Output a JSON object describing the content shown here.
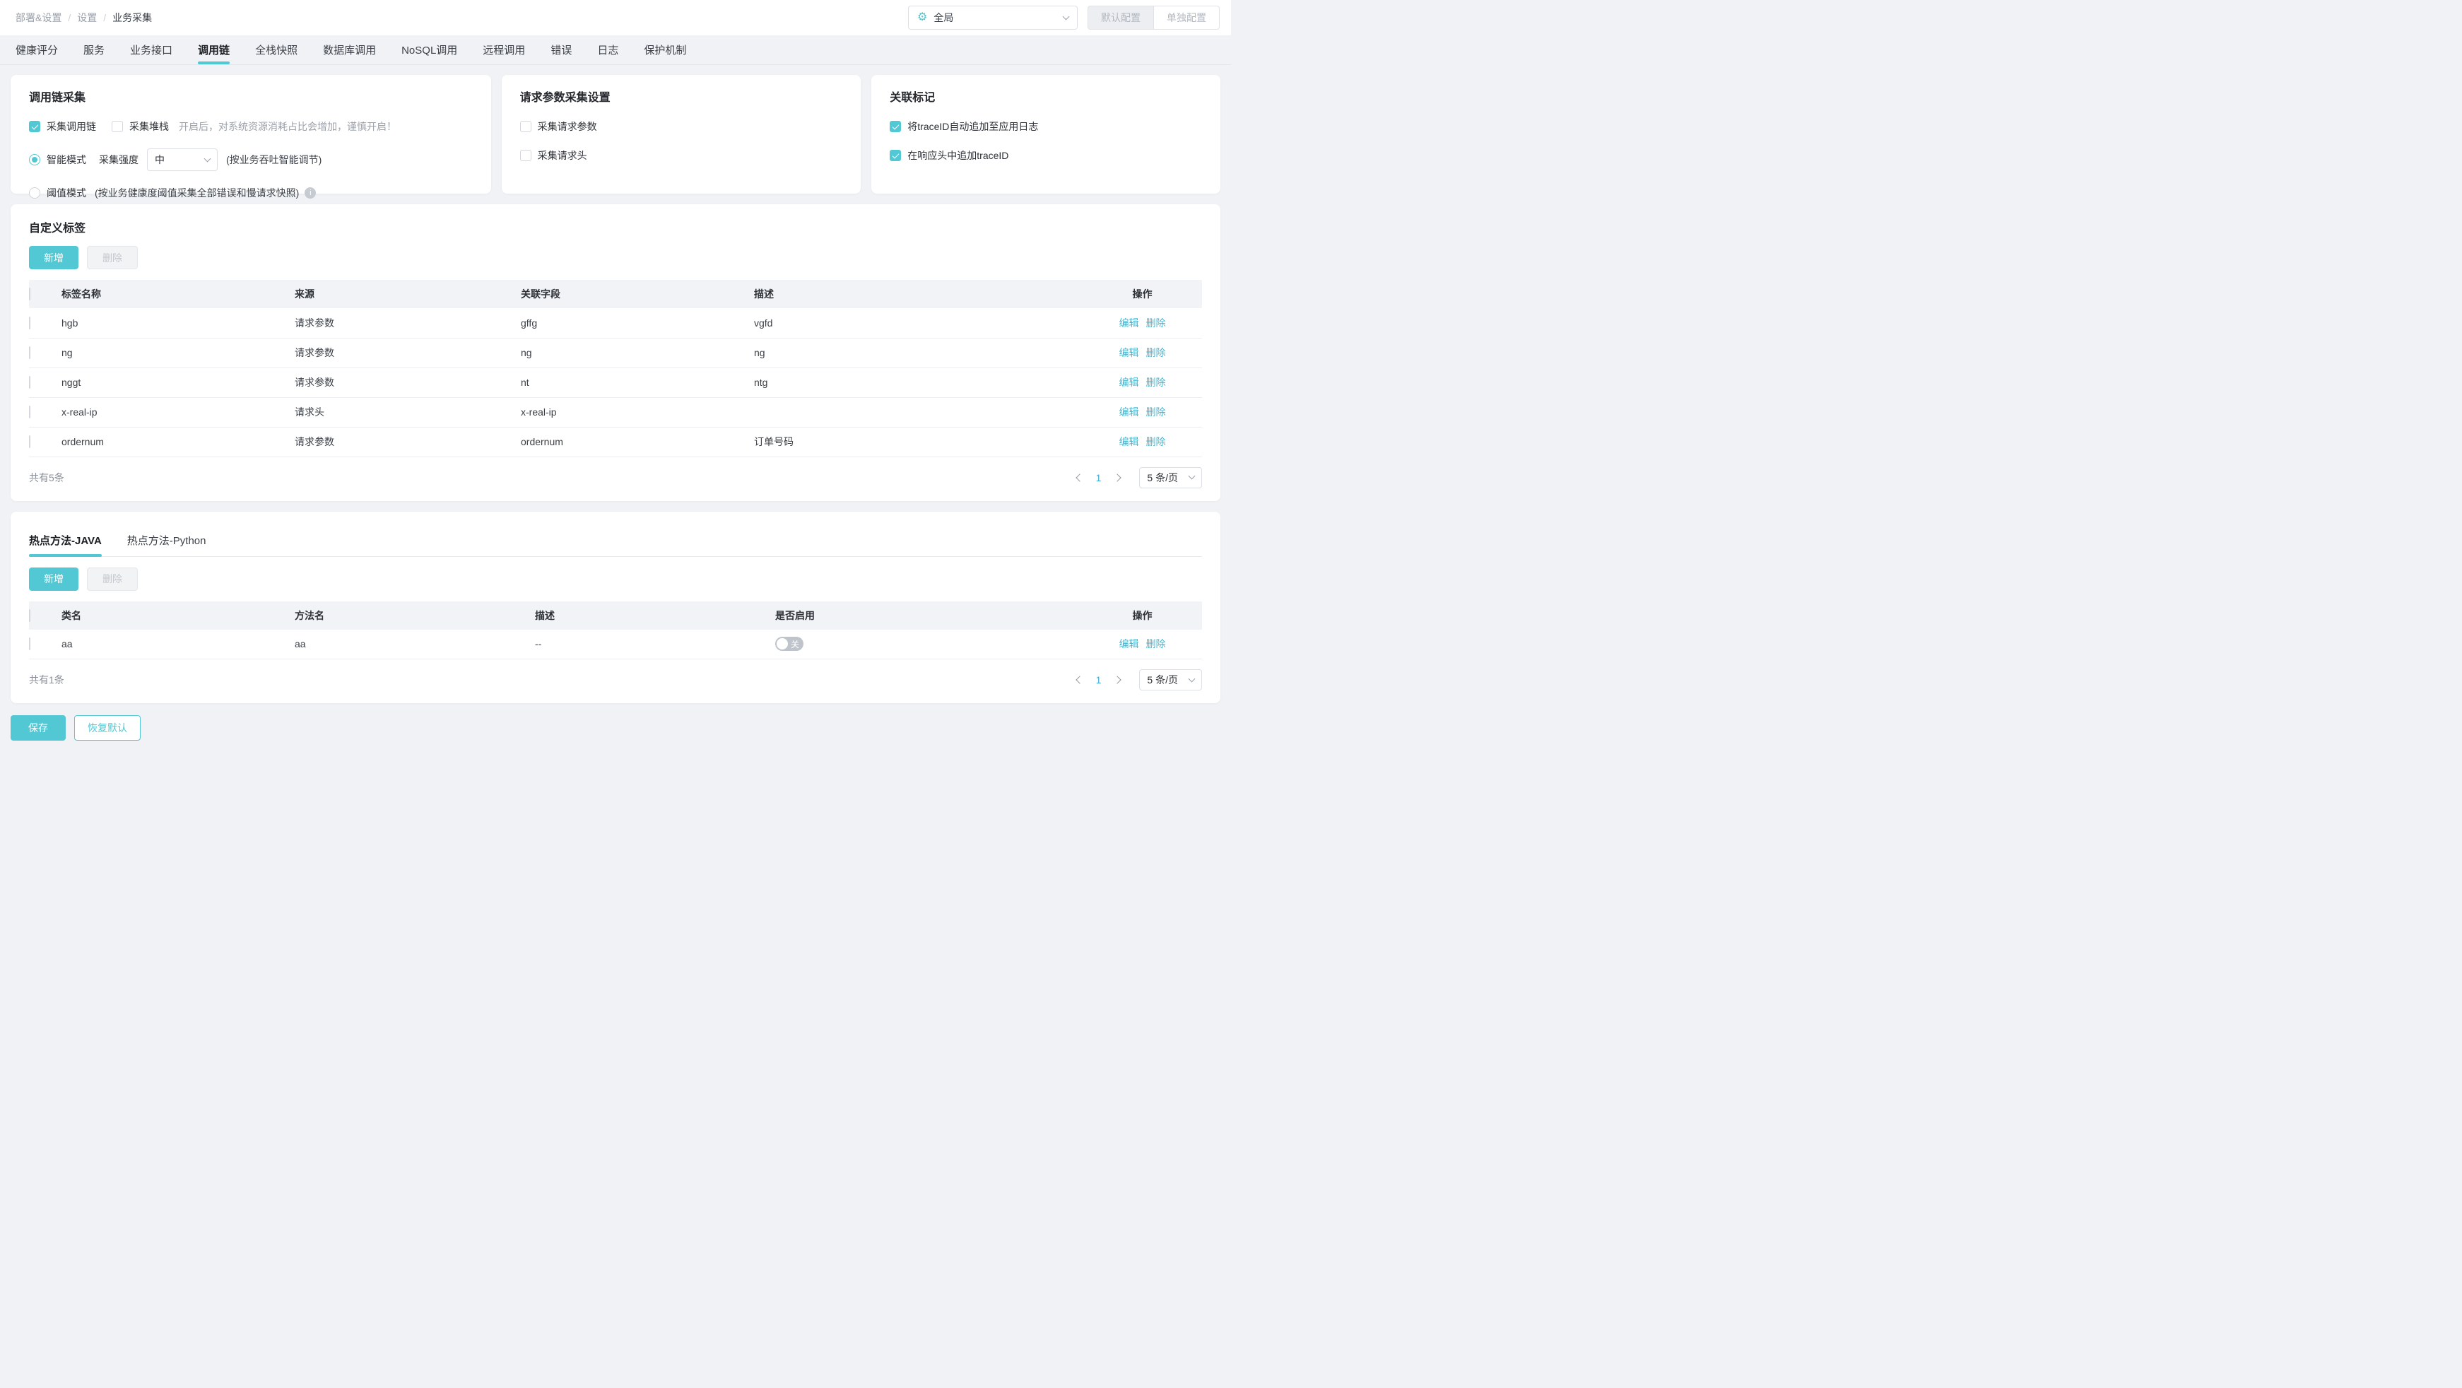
{
  "accent_color": "#52c8d4",
  "icons": {
    "gear": "⚙",
    "info": "i"
  },
  "breadcrumb": {
    "items": [
      "部署&设置",
      "设置",
      "业务采集"
    ],
    "separator": "/"
  },
  "header": {
    "scope_select": {
      "value": "全局"
    },
    "default_config_btn": "默认配置",
    "separate_config_btn": "单独配置"
  },
  "tabs": [
    "健康评分",
    "服务",
    "业务接口",
    "调用链",
    "全栈快照",
    "数据库调用",
    "NoSQL调用",
    "远程调用",
    "错误",
    "日志",
    "保护机制"
  ],
  "active_tab": "调用链",
  "panels": {
    "trace_collection": {
      "title": "调用链采集",
      "collect_trace": {
        "label": "采集调用链",
        "checked": true
      },
      "collect_stack": {
        "label": "采集堆栈",
        "checked": false,
        "hint": "开启后，对系统资源消耗占比会增加，谨慎开启！"
      },
      "smart_mode": {
        "label": "智能模式",
        "selected": true,
        "intensity_label": "采集强度",
        "intensity_value": "中",
        "hint": "(按业务吞吐智能调节)"
      },
      "threshold_mode": {
        "label": "阈值模式",
        "selected": false,
        "hint": "(按业务健康度阈值采集全部错误和慢请求快照)"
      }
    },
    "request_params": {
      "title": "请求参数采集设置",
      "collect_params": {
        "label": "采集请求参数",
        "checked": false
      },
      "collect_headers": {
        "label": "采集请求头",
        "checked": false
      }
    },
    "association": {
      "title": "关联标记",
      "append_trace_to_log": {
        "label": "将traceID自动追加至应用日志",
        "checked": true
      },
      "append_trace_to_header": {
        "label": "在响应头中追加traceID",
        "checked": true
      }
    }
  },
  "custom_tags": {
    "title": "自定义标签",
    "add_btn": "新增",
    "delete_btn": "删除",
    "columns": {
      "name": "标签名称",
      "source": "来源",
      "field": "关联字段",
      "desc": "描述",
      "op": "操作"
    },
    "rows": [
      {
        "name": "hgb",
        "source": "请求参数",
        "field": "gffg",
        "desc": "vgfd"
      },
      {
        "name": "ng",
        "source": "请求参数",
        "field": "ng",
        "desc": "ng"
      },
      {
        "name": "nggt",
        "source": "请求参数",
        "field": "nt",
        "desc": "ntg"
      },
      {
        "name": "x-real-ip",
        "source": "请求头",
        "field": "x-real-ip",
        "desc": ""
      },
      {
        "name": "ordernum",
        "source": "请求参数",
        "field": "ordernum",
        "desc": "订单号码"
      }
    ],
    "edit_label": "编辑",
    "delete_label": "删除",
    "total": "共有5条",
    "page": "1",
    "page_size": "5 条/页"
  },
  "hot_methods": {
    "tabs": [
      "热点方法-JAVA",
      "热点方法-Python"
    ],
    "active_tab": "热点方法-JAVA",
    "add_btn": "新增",
    "delete_btn": "删除",
    "columns": {
      "class_name": "类名",
      "method": "方法名",
      "desc": "描述",
      "enabled": "是否启用",
      "op": "操作"
    },
    "rows": [
      {
        "class_name": "aa",
        "method": "aa",
        "desc": "--",
        "enabled": false,
        "toggle_label": "关"
      }
    ],
    "edit_label": "编辑",
    "delete_label": "删除",
    "total": "共有1条",
    "page": "1",
    "page_size": "5 条/页"
  },
  "footer": {
    "save_btn": "保存",
    "reset_btn": "恢复默认"
  }
}
